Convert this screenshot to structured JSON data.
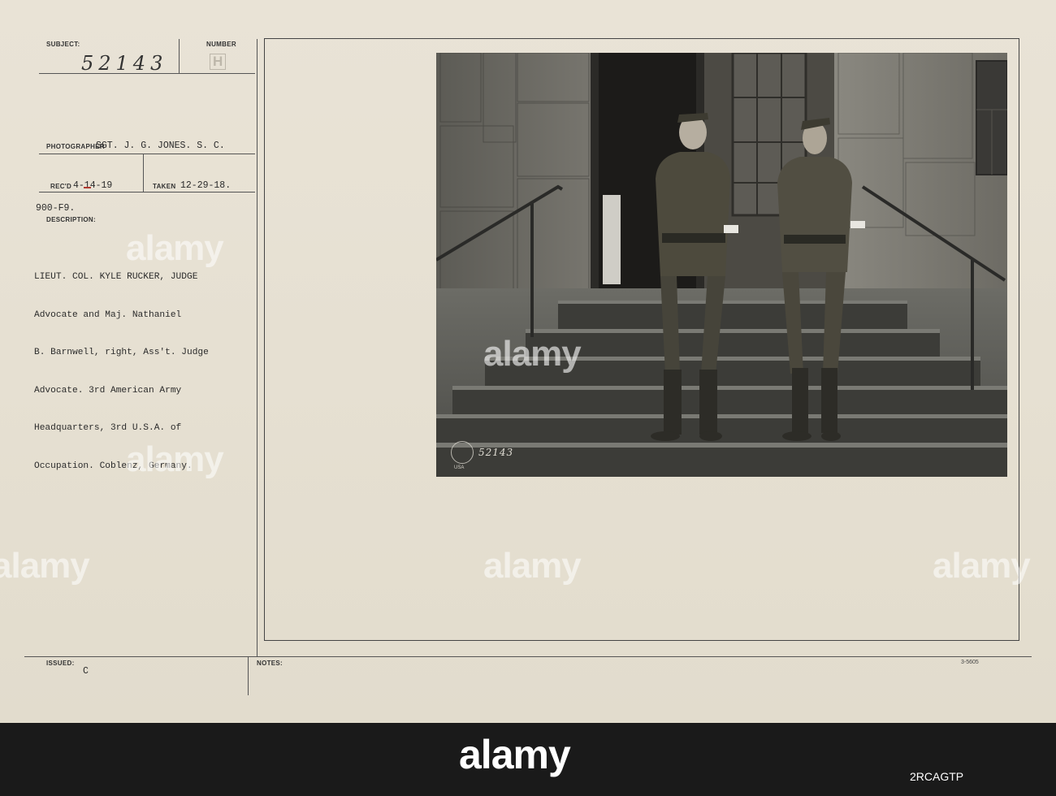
{
  "card": {
    "subject_label": "SUBJECT:",
    "subject_number": "52143",
    "number_label": "NUMBER",
    "number_value": "H",
    "photographer_label": "PHOTOGRAPHER",
    "photographer_value": "SGT. J. G. JONES. S. C.",
    "recd_label": "REC'D",
    "recd_value": "4-14-19",
    "taken_label": "TAKEN",
    "taken_value": "12-29-18.",
    "file_code": "900-F9.",
    "description_label": "DESCRIPTION:",
    "description_lines": [
      "LIEUT. COL. KYLE RUCKER, JUDGE",
      "Advocate and Maj. Nathaniel",
      "B. Barnwell, right, Ass't. Judge",
      "Advocate. 3rd American Army",
      "Headquarters, 3rd U.S.A. of",
      "Occupation. Coblenz, Germany."
    ],
    "issued_label": "ISSUED:",
    "issued_value": "C",
    "notes_label": "NOTES:",
    "form_number": "3-5605",
    "photo_stamp_number": "52143",
    "photo_stamp_org": "USA"
  },
  "watermarks": [
    "alamy",
    "alamy",
    "alamy",
    "alamy",
    "alamy",
    "alamy"
  ],
  "footer": {
    "logo": "alamy",
    "image_id": "2RCAGTP"
  },
  "colors": {
    "card_bg": "#e6e0d2",
    "ink": "#2b2b2b",
    "footer_bg": "#1a1a1a",
    "red_mark": "#b0392f"
  }
}
